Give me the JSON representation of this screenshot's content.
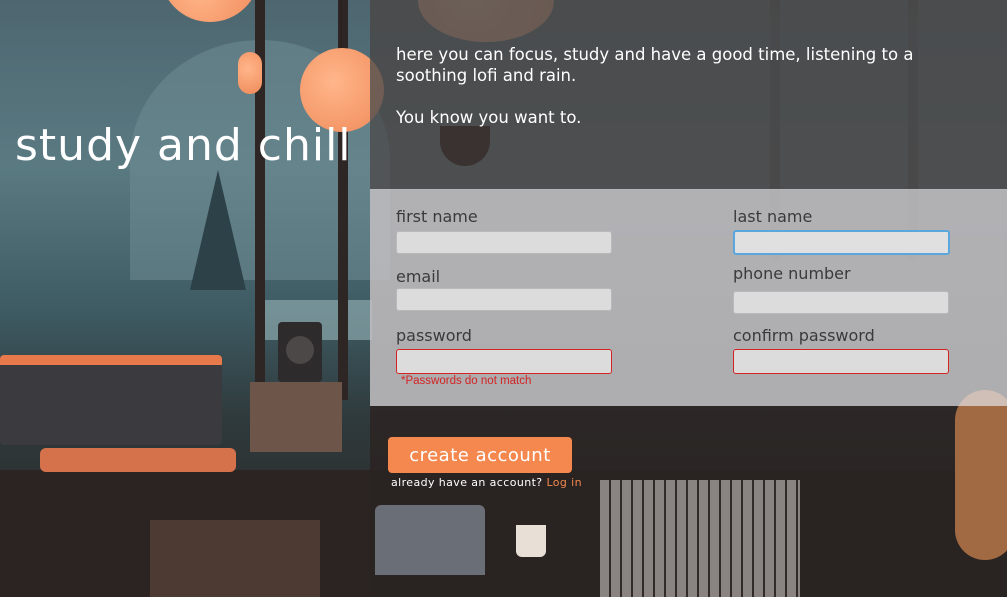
{
  "left": {
    "title": "study and chill"
  },
  "intro": {
    "line1": "here you can focus, study and have a good time, listening to a soothing lofi and rain.",
    "line2": "You know you want to."
  },
  "form": {
    "first_name": {
      "label": "first name",
      "value": ""
    },
    "last_name": {
      "label": "last name",
      "value": ""
    },
    "email": {
      "label": "email",
      "value": ""
    },
    "phone": {
      "label": "phone number",
      "value": ""
    },
    "password": {
      "label": "password",
      "value": ""
    },
    "confirm_password": {
      "label": "confirm password",
      "value": ""
    },
    "error": "*Passwords do not match"
  },
  "actions": {
    "create_label": "create account",
    "login_prompt": "already have an account?",
    "login_link": "Log in"
  },
  "colors": {
    "accent": "#f4884f",
    "error": "#d42323",
    "focus": "#5aa7de"
  }
}
